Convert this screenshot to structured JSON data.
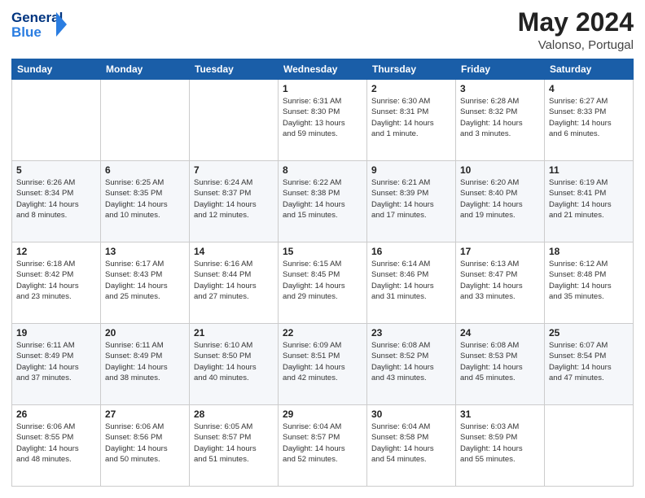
{
  "logo": {
    "line1": "General",
    "line2": "Blue"
  },
  "title": "May 2024",
  "subtitle": "Valonso, Portugal",
  "days_of_week": [
    "Sunday",
    "Monday",
    "Tuesday",
    "Wednesday",
    "Thursday",
    "Friday",
    "Saturday"
  ],
  "weeks": [
    [
      {
        "day": "",
        "info": ""
      },
      {
        "day": "",
        "info": ""
      },
      {
        "day": "",
        "info": ""
      },
      {
        "day": "1",
        "info": "Sunrise: 6:31 AM\nSunset: 8:30 PM\nDaylight: 13 hours\nand 59 minutes."
      },
      {
        "day": "2",
        "info": "Sunrise: 6:30 AM\nSunset: 8:31 PM\nDaylight: 14 hours\nand 1 minute."
      },
      {
        "day": "3",
        "info": "Sunrise: 6:28 AM\nSunset: 8:32 PM\nDaylight: 14 hours\nand 3 minutes."
      },
      {
        "day": "4",
        "info": "Sunrise: 6:27 AM\nSunset: 8:33 PM\nDaylight: 14 hours\nand 6 minutes."
      }
    ],
    [
      {
        "day": "5",
        "info": "Sunrise: 6:26 AM\nSunset: 8:34 PM\nDaylight: 14 hours\nand 8 minutes."
      },
      {
        "day": "6",
        "info": "Sunrise: 6:25 AM\nSunset: 8:35 PM\nDaylight: 14 hours\nand 10 minutes."
      },
      {
        "day": "7",
        "info": "Sunrise: 6:24 AM\nSunset: 8:37 PM\nDaylight: 14 hours\nand 12 minutes."
      },
      {
        "day": "8",
        "info": "Sunrise: 6:22 AM\nSunset: 8:38 PM\nDaylight: 14 hours\nand 15 minutes."
      },
      {
        "day": "9",
        "info": "Sunrise: 6:21 AM\nSunset: 8:39 PM\nDaylight: 14 hours\nand 17 minutes."
      },
      {
        "day": "10",
        "info": "Sunrise: 6:20 AM\nSunset: 8:40 PM\nDaylight: 14 hours\nand 19 minutes."
      },
      {
        "day": "11",
        "info": "Sunrise: 6:19 AM\nSunset: 8:41 PM\nDaylight: 14 hours\nand 21 minutes."
      }
    ],
    [
      {
        "day": "12",
        "info": "Sunrise: 6:18 AM\nSunset: 8:42 PM\nDaylight: 14 hours\nand 23 minutes."
      },
      {
        "day": "13",
        "info": "Sunrise: 6:17 AM\nSunset: 8:43 PM\nDaylight: 14 hours\nand 25 minutes."
      },
      {
        "day": "14",
        "info": "Sunrise: 6:16 AM\nSunset: 8:44 PM\nDaylight: 14 hours\nand 27 minutes."
      },
      {
        "day": "15",
        "info": "Sunrise: 6:15 AM\nSunset: 8:45 PM\nDaylight: 14 hours\nand 29 minutes."
      },
      {
        "day": "16",
        "info": "Sunrise: 6:14 AM\nSunset: 8:46 PM\nDaylight: 14 hours\nand 31 minutes."
      },
      {
        "day": "17",
        "info": "Sunrise: 6:13 AM\nSunset: 8:47 PM\nDaylight: 14 hours\nand 33 minutes."
      },
      {
        "day": "18",
        "info": "Sunrise: 6:12 AM\nSunset: 8:48 PM\nDaylight: 14 hours\nand 35 minutes."
      }
    ],
    [
      {
        "day": "19",
        "info": "Sunrise: 6:11 AM\nSunset: 8:49 PM\nDaylight: 14 hours\nand 37 minutes."
      },
      {
        "day": "20",
        "info": "Sunrise: 6:11 AM\nSunset: 8:49 PM\nDaylight: 14 hours\nand 38 minutes."
      },
      {
        "day": "21",
        "info": "Sunrise: 6:10 AM\nSunset: 8:50 PM\nDaylight: 14 hours\nand 40 minutes."
      },
      {
        "day": "22",
        "info": "Sunrise: 6:09 AM\nSunset: 8:51 PM\nDaylight: 14 hours\nand 42 minutes."
      },
      {
        "day": "23",
        "info": "Sunrise: 6:08 AM\nSunset: 8:52 PM\nDaylight: 14 hours\nand 43 minutes."
      },
      {
        "day": "24",
        "info": "Sunrise: 6:08 AM\nSunset: 8:53 PM\nDaylight: 14 hours\nand 45 minutes."
      },
      {
        "day": "25",
        "info": "Sunrise: 6:07 AM\nSunset: 8:54 PM\nDaylight: 14 hours\nand 47 minutes."
      }
    ],
    [
      {
        "day": "26",
        "info": "Sunrise: 6:06 AM\nSunset: 8:55 PM\nDaylight: 14 hours\nand 48 minutes."
      },
      {
        "day": "27",
        "info": "Sunrise: 6:06 AM\nSunset: 8:56 PM\nDaylight: 14 hours\nand 50 minutes."
      },
      {
        "day": "28",
        "info": "Sunrise: 6:05 AM\nSunset: 8:57 PM\nDaylight: 14 hours\nand 51 minutes."
      },
      {
        "day": "29",
        "info": "Sunrise: 6:04 AM\nSunset: 8:57 PM\nDaylight: 14 hours\nand 52 minutes."
      },
      {
        "day": "30",
        "info": "Sunrise: 6:04 AM\nSunset: 8:58 PM\nDaylight: 14 hours\nand 54 minutes."
      },
      {
        "day": "31",
        "info": "Sunrise: 6:03 AM\nSunset: 8:59 PM\nDaylight: 14 hours\nand 55 minutes."
      },
      {
        "day": "",
        "info": ""
      }
    ]
  ]
}
